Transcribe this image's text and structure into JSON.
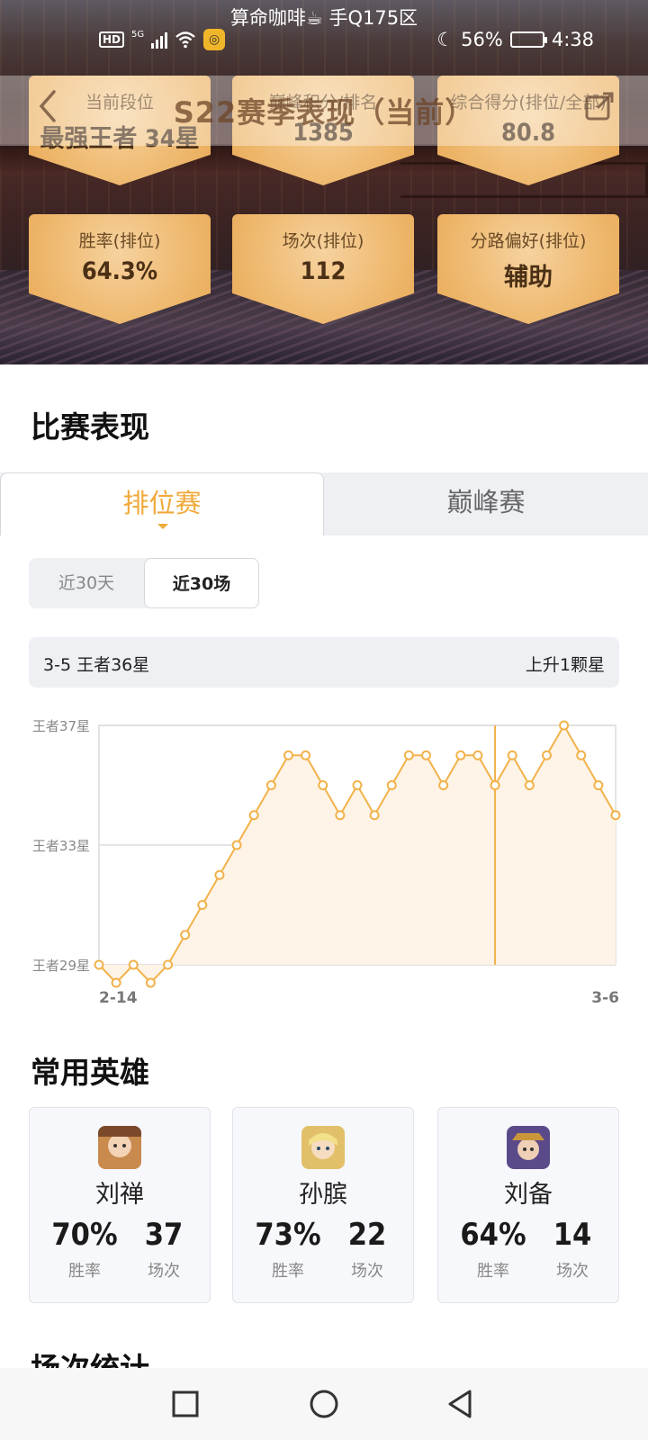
{
  "status": {
    "top_text": "算命咖啡☕ 手Q175区",
    "hd": "HD",
    "net": "5G",
    "battery_pct": "56%",
    "time": "4:38",
    "battery_level": 0.56,
    "app_badge_icon": "game-assistant-icon"
  },
  "nav": {
    "title": "S22赛季表现（当前）",
    "back_icon": "chevron-left-icon",
    "share_icon": "share-icon"
  },
  "stats": {
    "rank": {
      "label": "当前段位",
      "value": "最强王者 34星"
    },
    "top_score": {
      "label": "巅峰积分/排名",
      "value": "1385"
    },
    "composite": {
      "label": "综合得分(排位/全部)",
      "value": "80.8"
    },
    "win_rate": {
      "label": "胜率(排位)",
      "value": "64.3%"
    },
    "games": {
      "label": "场次(排位)",
      "value": "112"
    },
    "lane": {
      "label": "分路偏好(排位)",
      "value": "辅助"
    }
  },
  "performance": {
    "title": "比赛表现",
    "tabs": [
      {
        "label": "排位赛",
        "active": true
      },
      {
        "label": "巅峰赛",
        "active": false
      }
    ],
    "segments": [
      {
        "label": "近30天",
        "active": false
      },
      {
        "label": "近30场",
        "active": true
      }
    ],
    "summary_left": "3-5 王者36星",
    "summary_right": "上升1颗星"
  },
  "chart_data": {
    "type": "area",
    "y_tick_labels": [
      "王者37星",
      "王者33星",
      "王者29星"
    ],
    "y_ticks": [
      37,
      33,
      29
    ],
    "ylim": [
      29,
      37
    ],
    "x_start_label": "2-14",
    "x_end_label": "3-6",
    "values": [
      29,
      28.4,
      29,
      28.4,
      29,
      30,
      31,
      32,
      33,
      34,
      35,
      36,
      36,
      35,
      34,
      35,
      34,
      35,
      36,
      36,
      35,
      36,
      36,
      35,
      36,
      35,
      36,
      37,
      36,
      35,
      34
    ],
    "highlight_index": 23,
    "color": "#f2b24a",
    "fill": "#fdf3e6"
  },
  "heroes": {
    "title": "常用英雄",
    "items": [
      {
        "name": "刘禅",
        "win_rate": "70%",
        "games": "37",
        "win_label": "胜率",
        "games_label": "场次",
        "avatar_color": "#c98a4e"
      },
      {
        "name": "孙膑",
        "win_rate": "73%",
        "games": "22",
        "win_label": "胜率",
        "games_label": "场次",
        "avatar_color": "#e2c06a"
      },
      {
        "name": "刘备",
        "win_rate": "64%",
        "games": "14",
        "win_label": "胜率",
        "games_label": "场次",
        "avatar_color": "#5a4a8a"
      }
    ]
  },
  "next_section": {
    "title": "场次统计"
  },
  "colors": {
    "accent": "#f0a93a",
    "card_gold": "#efbb73"
  }
}
